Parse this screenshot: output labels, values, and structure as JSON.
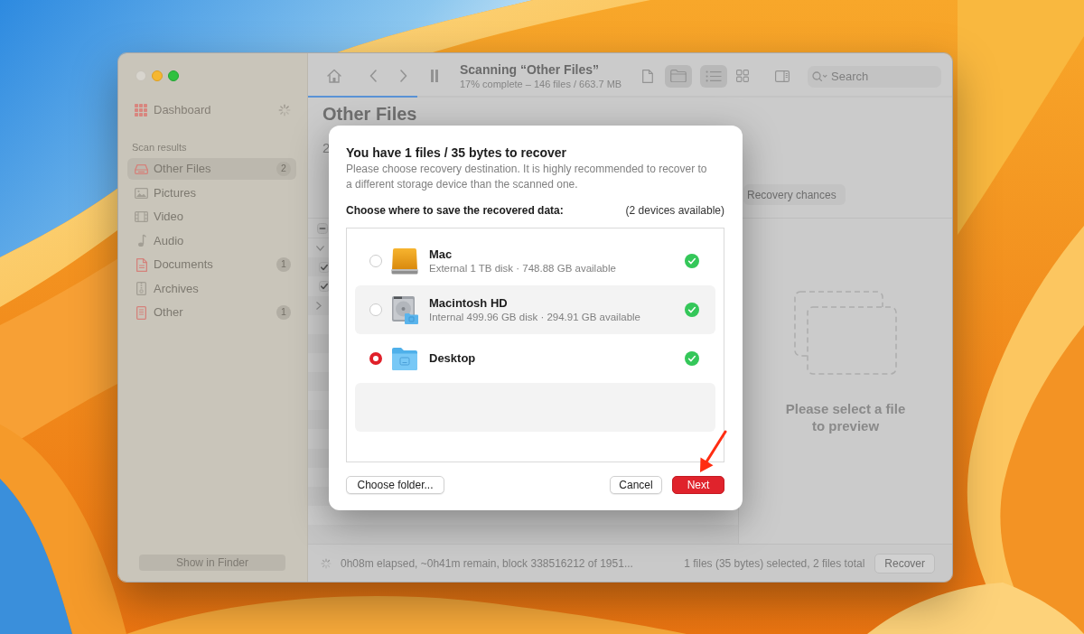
{
  "window": {
    "close_disabled": true
  },
  "sidebar": {
    "dashboard": "Dashboard",
    "section_title": "Scan results",
    "items": [
      {
        "kind": "drive",
        "label": "Other Files",
        "count": "2",
        "selected": true
      },
      {
        "kind": "pictures",
        "label": "Pictures",
        "selected": false
      },
      {
        "kind": "video",
        "label": "Video",
        "selected": false
      },
      {
        "kind": "audio",
        "label": "Audio",
        "selected": false
      },
      {
        "kind": "document",
        "label": "Documents",
        "count": "1",
        "selected": false
      },
      {
        "kind": "archive",
        "label": "Archives",
        "selected": false
      },
      {
        "kind": "other",
        "label": "Other",
        "count": "1",
        "selected": false
      }
    ],
    "footer_button": "Show in Finder"
  },
  "toolbar": {
    "title": "Scanning “Other Files”",
    "subtitle": "17% complete – 146 files / 663.7 MB",
    "progress": {
      "level": 0.17
    },
    "view_buttons": [
      {
        "kind": "file",
        "selected": false
      },
      {
        "kind": "folder",
        "selected": true
      },
      {
        "kind": "list",
        "selected": true
      },
      {
        "kind": "grid",
        "selected": false
      }
    ],
    "search": {
      "placeholder": "Search"
    }
  },
  "content": {
    "heading": "Other Files",
    "subheading": "2",
    "filter_button": "Recovery chances",
    "select_all": {
      "partial": true
    },
    "tree": [
      {
        "expanded": true,
        "children": [
          {
            "checked": true
          },
          {
            "checked": true
          }
        ]
      },
      {
        "expanded": false
      }
    ],
    "preview_message": "Please select a file to preview"
  },
  "status_bar": {
    "progress_text": "0h08m elapsed, ~0h41m remain, block 338516212 of 1951...",
    "selection_text": "1 files (35 bytes) selected, 2 files total",
    "recover_button": "Recover"
  },
  "dialog": {
    "title": "You have 1 files / 35 bytes to recover",
    "description": "Please choose recovery destination. It is highly recommended to recover to a different storage device than the scanned one.",
    "list_label": "Choose where to save the recovered data:",
    "availability": "(2 devices available)",
    "destinations": [
      {
        "kind": "external_disk",
        "name": "Mac",
        "details": "External 1 TB disk · 748.88 GB available",
        "selected": false,
        "ready": true
      },
      {
        "kind": "internal_disk",
        "name": "Macintosh HD",
        "details": "Internal 499.96 GB disk · 294.91 GB available",
        "selected": false,
        "ready": true
      },
      {
        "kind": "folder",
        "name": "Desktop",
        "selected": true,
        "ready": true
      }
    ],
    "buttons": {
      "choose_folder": "Choose folder...",
      "cancel": "Cancel",
      "next": "Next"
    }
  }
}
